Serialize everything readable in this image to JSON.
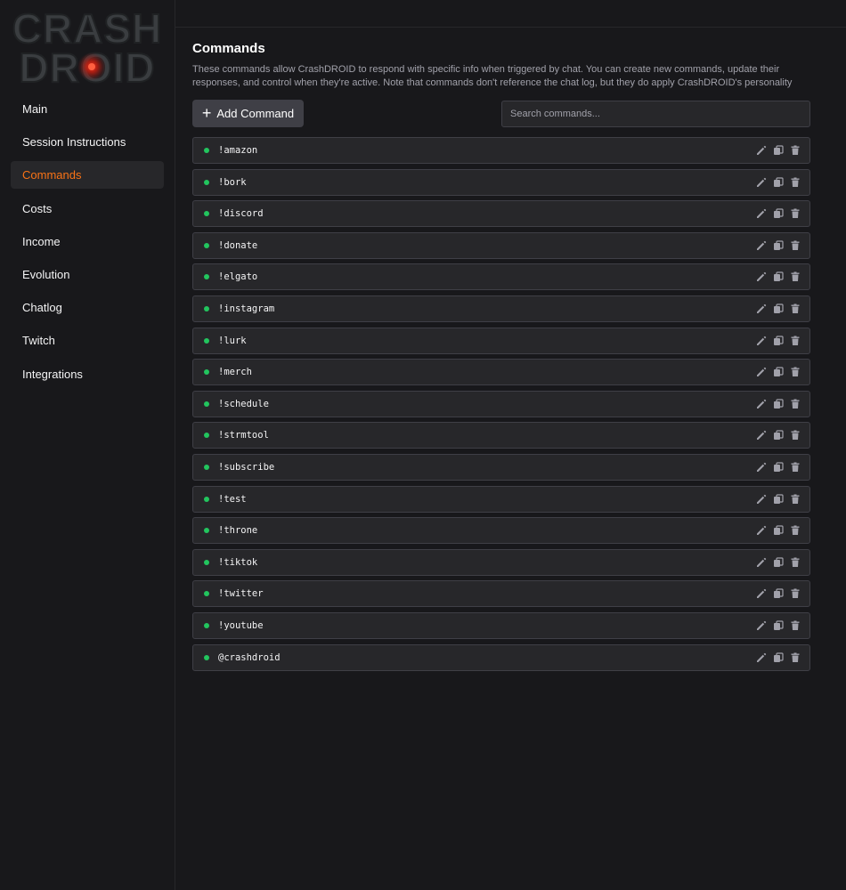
{
  "logo": {
    "line1": "CRASH",
    "line2": "DROID"
  },
  "sidebar": {
    "items": [
      {
        "label": "Main",
        "active": false
      },
      {
        "label": "Session Instructions",
        "active": false
      },
      {
        "label": "Commands",
        "active": true
      },
      {
        "label": "Costs",
        "active": false
      },
      {
        "label": "Income",
        "active": false
      },
      {
        "label": "Evolution",
        "active": false
      },
      {
        "label": "Chatlog",
        "active": false
      },
      {
        "label": "Twitch",
        "active": false
      },
      {
        "label": "Integrations",
        "active": false
      }
    ]
  },
  "main": {
    "title": "Commands",
    "description": "These commands allow CrashDROID to respond with specific info when triggered by chat. You can create new commands, update their responses, and control when they're active. Note that commands don't reference the chat log, but they do apply CrashDROID's personality",
    "add_button": "Add Command",
    "search_placeholder": "Search commands...",
    "commands": [
      "!amazon",
      "!bork",
      "!discord",
      "!donate",
      "!elgato",
      "!instagram",
      "!lurk",
      "!merch",
      "!schedule",
      "!strmtool",
      "!subscribe",
      "!test",
      "!throne",
      "!tiktok",
      "!twitter",
      "!youtube",
      "@crashdroid"
    ]
  },
  "colors": {
    "accent": "#f97316",
    "active_dot": "#22c55e",
    "background": "#18181b",
    "row_bg": "#27272a"
  }
}
